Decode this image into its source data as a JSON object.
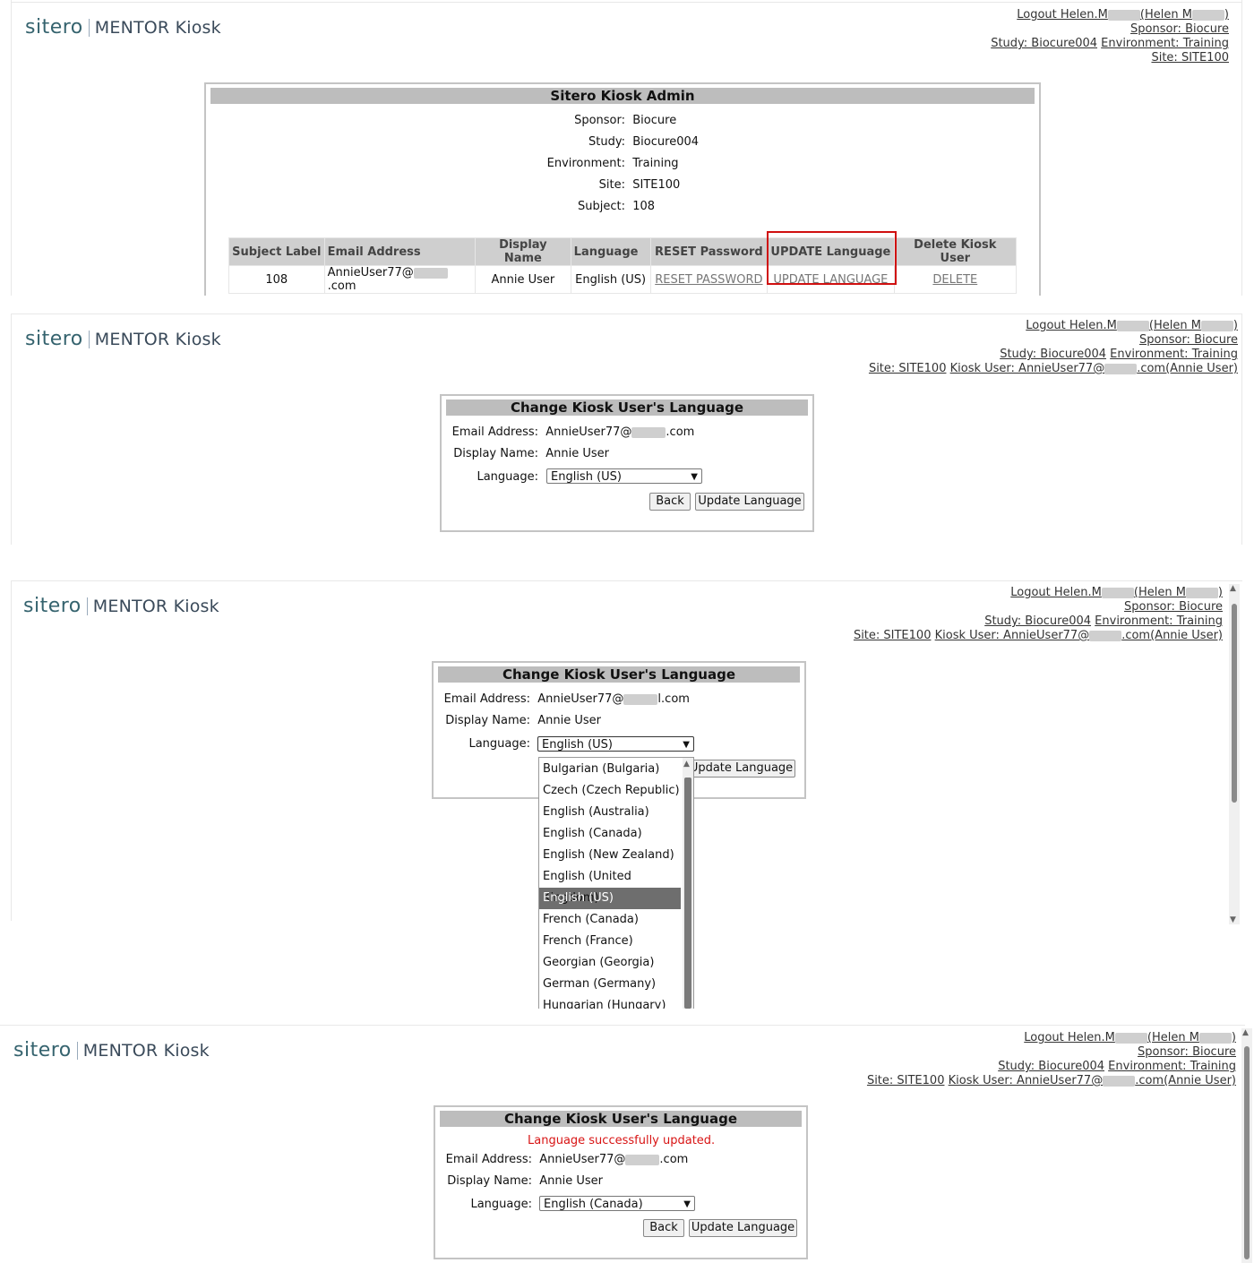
{
  "header": {
    "logo_mark": "sitero",
    "logo_text": "MENTOR Kiosk",
    "logout_prefix": "Logout Helen.M",
    "logout_mid": "(Helen M",
    "logout_end": ")",
    "sponsor_link": "Sponsor: Biocure",
    "study_link": "Study: Biocure004",
    "environment_link": "Environment: Training",
    "site_link": "Site: SITE100",
    "kiosk_user_prefix": "Kiosk User: AnnieUser77@",
    "kiosk_user_suffix": ".com(Annie User)"
  },
  "admin": {
    "title": "Sitero Kiosk Admin",
    "fields": [
      {
        "label": "Sponsor:",
        "value": "Biocure"
      },
      {
        "label": "Study:",
        "value": "Biocure004"
      },
      {
        "label": "Environment:",
        "value": "Training"
      },
      {
        "label": "Site:",
        "value": "SITE100"
      },
      {
        "label": "Subject:",
        "value": "108"
      }
    ],
    "columns": [
      "Subject Label",
      "Email Address",
      "Display Name",
      "Language",
      "RESET Password",
      "UPDATE Language",
      "Delete Kiosk User"
    ],
    "row": {
      "subject": "108",
      "email_prefix": "AnnieUser77@",
      "email_suffix": ".com",
      "display_name": "Annie User",
      "language": "English (US)",
      "reset": "RESET PASSWORD",
      "update": "UPDATE LANGUAGE",
      "delete": "DELETE"
    }
  },
  "change_form": {
    "title": "Change Kiosk User's Language",
    "email_label": "Email Address:",
    "email_prefix": "AnnieUser77@",
    "email_suffix": ".com",
    "email_suffix_alt": "l.com",
    "display_label": "Display Name:",
    "display_value": "Annie User",
    "language_label": "Language:",
    "language_value": "English (US)",
    "back_label": "Back",
    "update_label": "Update Language",
    "success_message": "Language successfully updated.",
    "language_value_after": "English (Canada)"
  },
  "language_options": [
    "Bulgarian (Bulgaria)",
    "Czech (Czech Republic)",
    "English (Australia)",
    "English (Canada)",
    "English (New Zealand)",
    "English (United Kingdom)",
    "English (US)",
    "French (Canada)",
    "French (France)",
    "Georgian (Georgia)",
    "German (Germany)",
    "Hungarian (Hungary)"
  ],
  "language_selected_index": 6
}
